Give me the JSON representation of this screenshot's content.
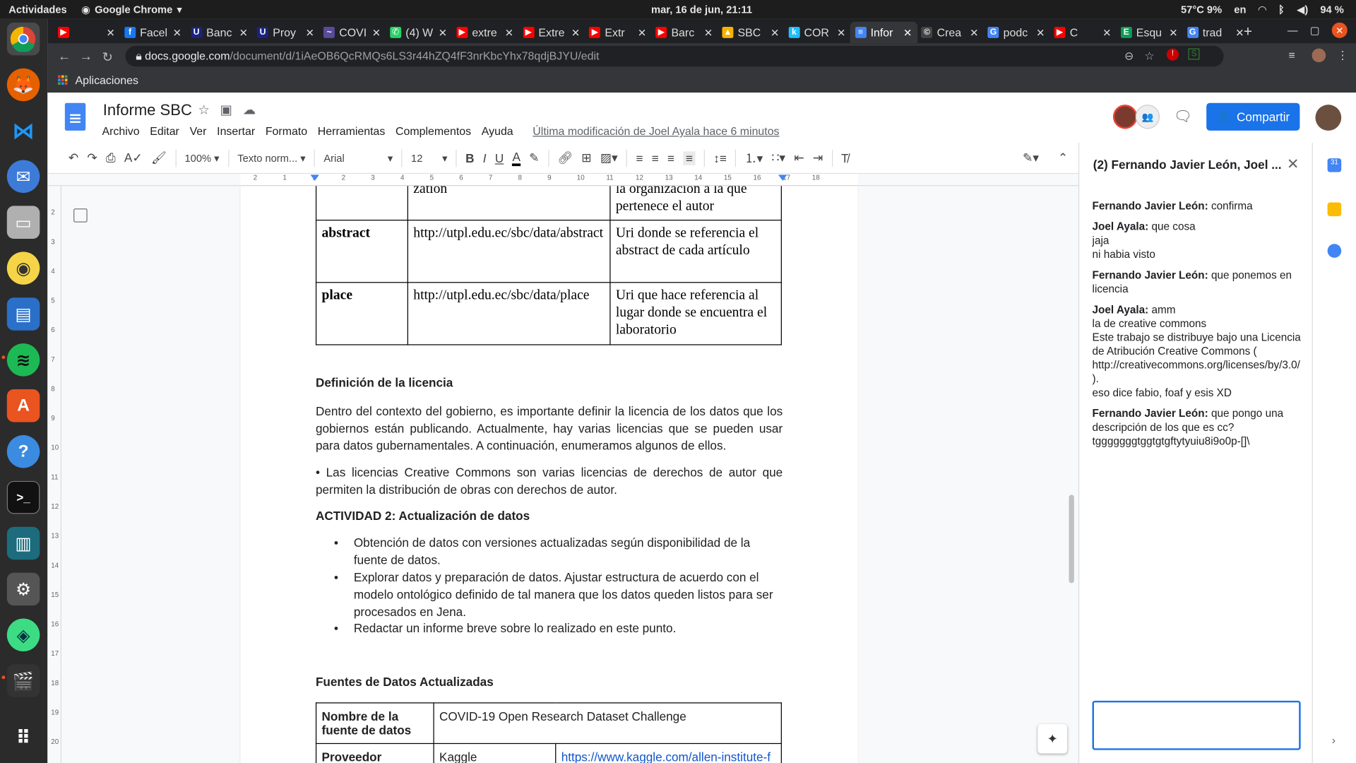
{
  "system": {
    "activities": "Actividades",
    "app": "Google Chrome",
    "clock": "mar, 16 de jun, 21:11",
    "temp": "57°C 9%",
    "lang": "en",
    "battery": "94 %"
  },
  "tabs": [
    {
      "label": "",
      "color": "#ff0000",
      "fav": "▶"
    },
    {
      "label": "Facel",
      "color": "#1877f2",
      "fav": "f"
    },
    {
      "label": "Banc",
      "color": "#1a237e",
      "fav": "U"
    },
    {
      "label": "Proy",
      "color": "#1a237e",
      "fav": "U"
    },
    {
      "label": "COVI",
      "color": "#5a4a9a",
      "fav": "~"
    },
    {
      "label": "(4) W",
      "color": "#25d366",
      "fav": "✆"
    },
    {
      "label": "extre",
      "color": "#ff0000",
      "fav": "▶"
    },
    {
      "label": "Extre",
      "color": "#ff0000",
      "fav": "▶"
    },
    {
      "label": "Extr",
      "color": "#ff0000",
      "fav": "▶"
    },
    {
      "label": "Barc",
      "color": "#ff0000",
      "fav": "▶"
    },
    {
      "label": "SBC",
      "color": "#f4b400",
      "fav": "▲"
    },
    {
      "label": "COR",
      "color": "#20beff",
      "fav": "k"
    },
    {
      "label": "Infor",
      "color": "#4285f4",
      "fav": "≡"
    },
    {
      "label": "Crea",
      "color": "#444",
      "fav": "©"
    },
    {
      "label": "podc",
      "color": "#4285f4",
      "fav": "G"
    },
    {
      "label": "C",
      "color": "#ff0000",
      "fav": "▶"
    },
    {
      "label": "Esqu",
      "color": "#0f9d58",
      "fav": "E"
    },
    {
      "label": "trad",
      "color": "#4285f4",
      "fav": "G"
    }
  ],
  "url": {
    "host": "docs.google.com",
    "path": "/document/d/1iAeOB6QcRMQs6LS3r44hZQ4fF3nrKbcYhx78qdjBJYU/edit"
  },
  "bookmarks": {
    "apps": "Aplicaciones"
  },
  "doc": {
    "title": "Informe SBC",
    "menus": [
      "Archivo",
      "Editar",
      "Ver",
      "Insertar",
      "Formato",
      "Herramientas",
      "Complementos",
      "Ayuda"
    ],
    "last_modified": "Última modificación de Joel Ayala hace 6 minutos",
    "share": "Compartir",
    "zoom": "100%",
    "style": "Texto norm...",
    "font": "Arial",
    "size": "12"
  },
  "table1": [
    [
      "",
      "zation",
      "la organización a la que pertenece el autor"
    ],
    [
      "abstract",
      "http://utpl.edu.ec/sbc/data/abstract",
      "Uri donde se referencia el abstract de cada artículo"
    ],
    [
      "place",
      "http://utpl.edu.ec/sbc/data/place",
      "Uri que hace referencia al lugar donde se encuentra el laboratorio"
    ]
  ],
  "body": {
    "h_licencia": "Definición de la licencia",
    "p1": "Dentro del contexto del gobierno, es importante definir la licencia de los datos que los gobiernos están publicando. Actualmente, hay varias licencias que se pueden usar para datos gubernamentales. A continuación, enumeramos algunos de ellos.",
    "p2": "• Las licencias Creative Commons son varias licencias de derechos de autor que permiten la distribución de obras con derechos de autor.",
    "h_act2": "ACTIVIDAD 2: Actualización de datos",
    "bullets": [
      "Obtención de datos con versiones actualizadas según disponibilidad de la fuente de datos.",
      "Explorar datos y preparación de datos. Ajustar estructura de acuerdo con el modelo ontológico definido de tal manera que los datos queden listos para ser procesados en Jena.",
      "Redactar un informe breve sobre lo realizado en este punto."
    ],
    "h_fuentes": "Fuentes de Datos Actualizadas"
  },
  "table2": {
    "r1k": "Nombre de la fuente de datos",
    "r1v": "COVID-19 Open Research Dataset Challenge",
    "r2k": "Proveedor",
    "r2v": "Kaggle",
    "r2l": "https://www.kaggle.com/allen-institute-f"
  },
  "chat": {
    "title": "(2) Fernando Javier León, Joel ...",
    "messages": [
      {
        "author": "Fernando Javier León:",
        "lines": [
          "confirma"
        ]
      },
      {
        "author": "Joel Ayala:",
        "lines": [
          "que cosa",
          "jaja",
          "ni habia visto"
        ]
      },
      {
        "author": "Fernando Javier León:",
        "lines": [
          "que ponemos en licencia"
        ]
      },
      {
        "author": "Joel Ayala:",
        "lines": [
          "amm",
          "la de creative commons",
          "Este trabajo se distribuye bajo una Licencia de Atribución Creative Commons ( http://creativecommons.org/licenses/by/3.0/ ).",
          "eso dice fabio, foaf y esis XD"
        ]
      },
      {
        "author": "Fernando Javier León:",
        "lines": [
          "que pongo una descripción de los que es cc?",
          "tgggggggtggtgtgftytyuiu8i9o0p-[]\\"
        ]
      }
    ]
  },
  "ruler_h": [
    "2",
    "1",
    "1",
    "2",
    "3",
    "4",
    "5",
    "6",
    "7",
    "8",
    "9",
    "10",
    "11",
    "12",
    "13",
    "14",
    "15",
    "16",
    "17",
    "18"
  ],
  "ruler_v": [
    "2",
    "3",
    "4",
    "5",
    "6",
    "7",
    "8",
    "9",
    "10",
    "11",
    "12",
    "13",
    "14",
    "15",
    "16",
    "17",
    "18",
    "19",
    "20"
  ]
}
